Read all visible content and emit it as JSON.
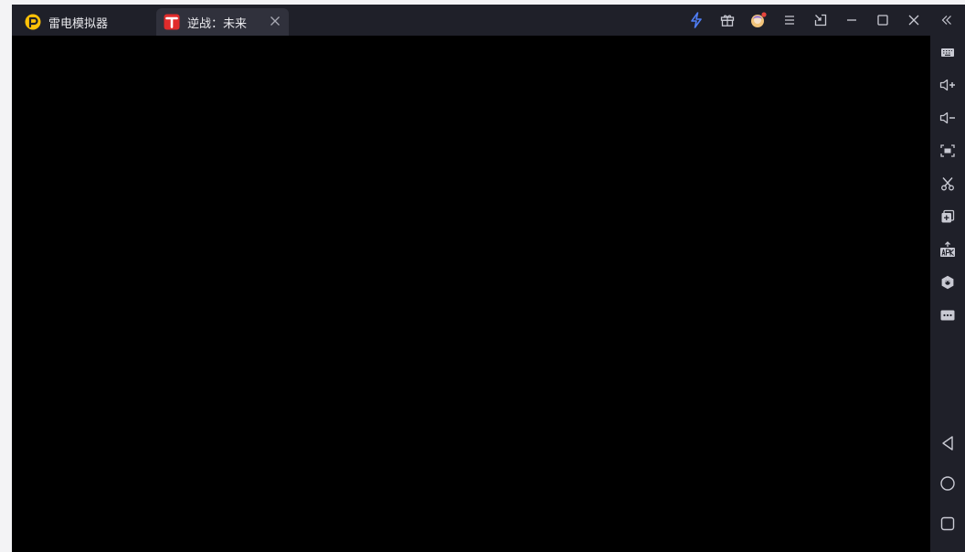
{
  "app": {
    "name": "雷电模拟器"
  },
  "tabs": [
    {
      "label": "雷电模拟器",
      "icon": "ldplayer-logo-icon",
      "active": false
    },
    {
      "label": "逆战：未来",
      "icon": "game-app-icon",
      "active": true
    }
  ],
  "titlebar_actions": [
    "speed-boost-icon",
    "gift-box-icon",
    "user-avatar-icon",
    "menu-icon",
    "screen-switch-icon",
    "minimize-icon",
    "maximize-icon",
    "close-icon",
    "collapse-sidebar-icon"
  ],
  "sidebar_tools": [
    "keyboard-mapping-icon",
    "volume-up-icon",
    "volume-down-icon",
    "screenshot-icon",
    "scissors-icon",
    "multi-instance-icon",
    "install-apk-icon",
    "settings-hex-icon",
    "more-icon"
  ],
  "nav_buttons": [
    "back-icon",
    "home-icon",
    "recents-icon"
  ],
  "colors": {
    "titlebar_bg": "#1f2029",
    "active_tab_bg": "#30313c",
    "icon_color": "#c9cad3",
    "boost_color": "#4f7df5",
    "notification_dot": "#e8453c",
    "logo_yellow": "#ffc107",
    "game_icon_red": "#e12b2b"
  }
}
